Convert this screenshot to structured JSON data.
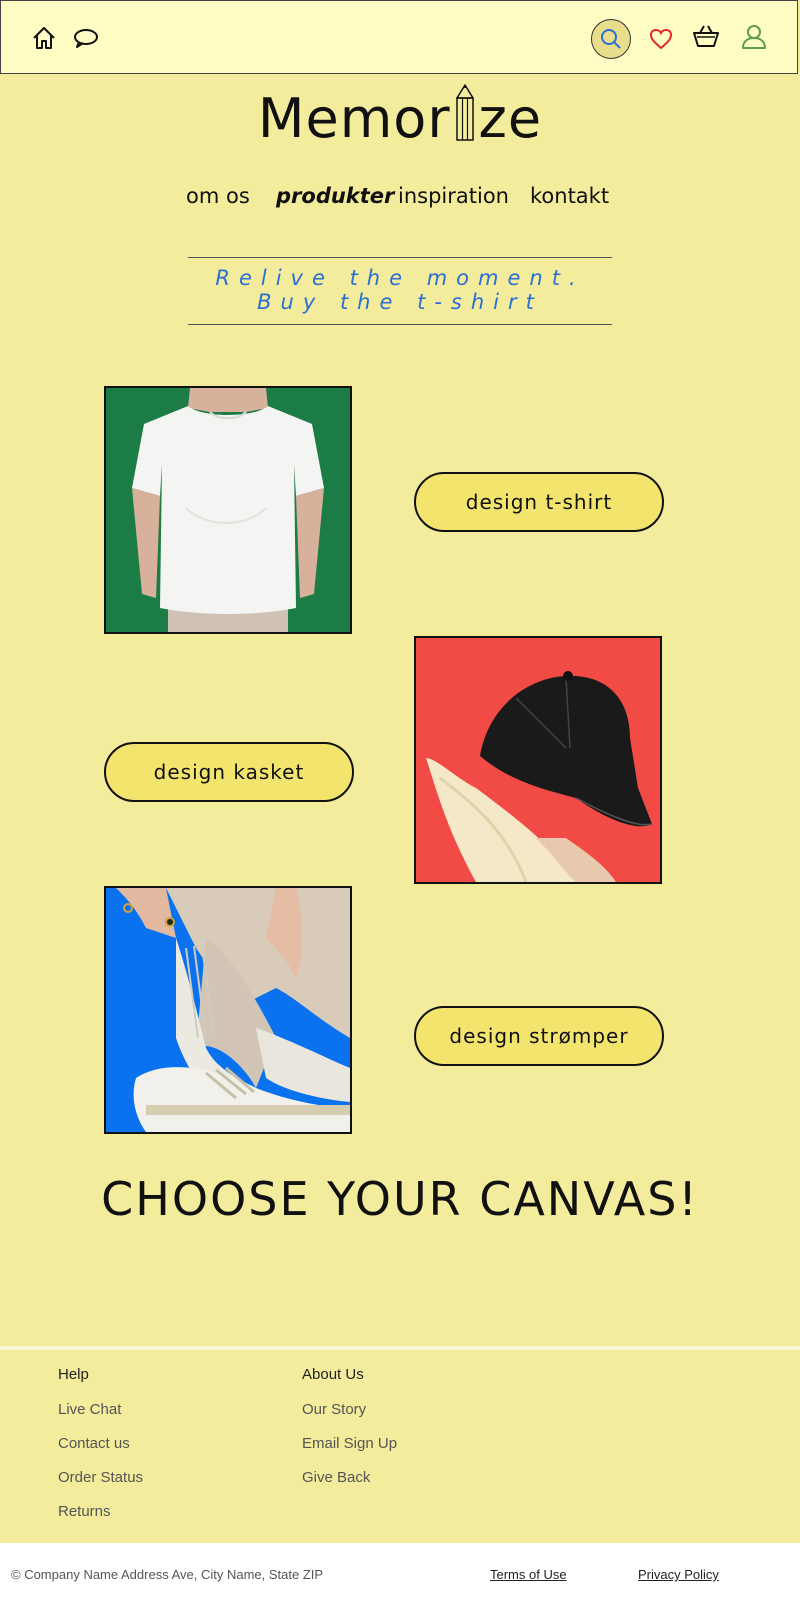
{
  "header": {
    "icons": [
      "home-icon",
      "chat-bubble-icon",
      "search-icon",
      "heart-icon",
      "basket-icon",
      "user-icon"
    ]
  },
  "logo": {
    "before": "Memor",
    "after": "ze"
  },
  "nav": {
    "items": [
      {
        "label": "om os"
      },
      {
        "label": "produkter"
      },
      {
        "label": "inspiration"
      },
      {
        "label": "kontakt"
      }
    ],
    "active": "produkter"
  },
  "slogan": {
    "line1": "Relive the moment.",
    "line2": "Buy the t-shirt"
  },
  "products": [
    {
      "button": "design t-shirt",
      "photo_bg": "#1c7c45"
    },
    {
      "button": "design kasket",
      "photo_bg": "#f24a44"
    },
    {
      "button": "design strømper",
      "photo_bg": "#0a72ee"
    }
  ],
  "headline": "CHOOSE YOUR CANVAS!",
  "footer": {
    "help": {
      "title": "Help",
      "links": [
        "Live Chat",
        "Contact us",
        "Order Status",
        "Returns"
      ]
    },
    "about": {
      "title": "About Us",
      "links": [
        "Our Story",
        "Email Sign Up",
        "Give Back"
      ]
    },
    "copyright": "© Company Name Address Ave, City Name, State ZIP",
    "terms": "Terms of Use",
    "privacy": "Privacy Policy"
  },
  "colors": {
    "background": "#f2ec9c",
    "topbar": "#fffdc4",
    "button": "#f3e46e",
    "slogan": "#2a6fd6",
    "heart": "#e0262e"
  }
}
